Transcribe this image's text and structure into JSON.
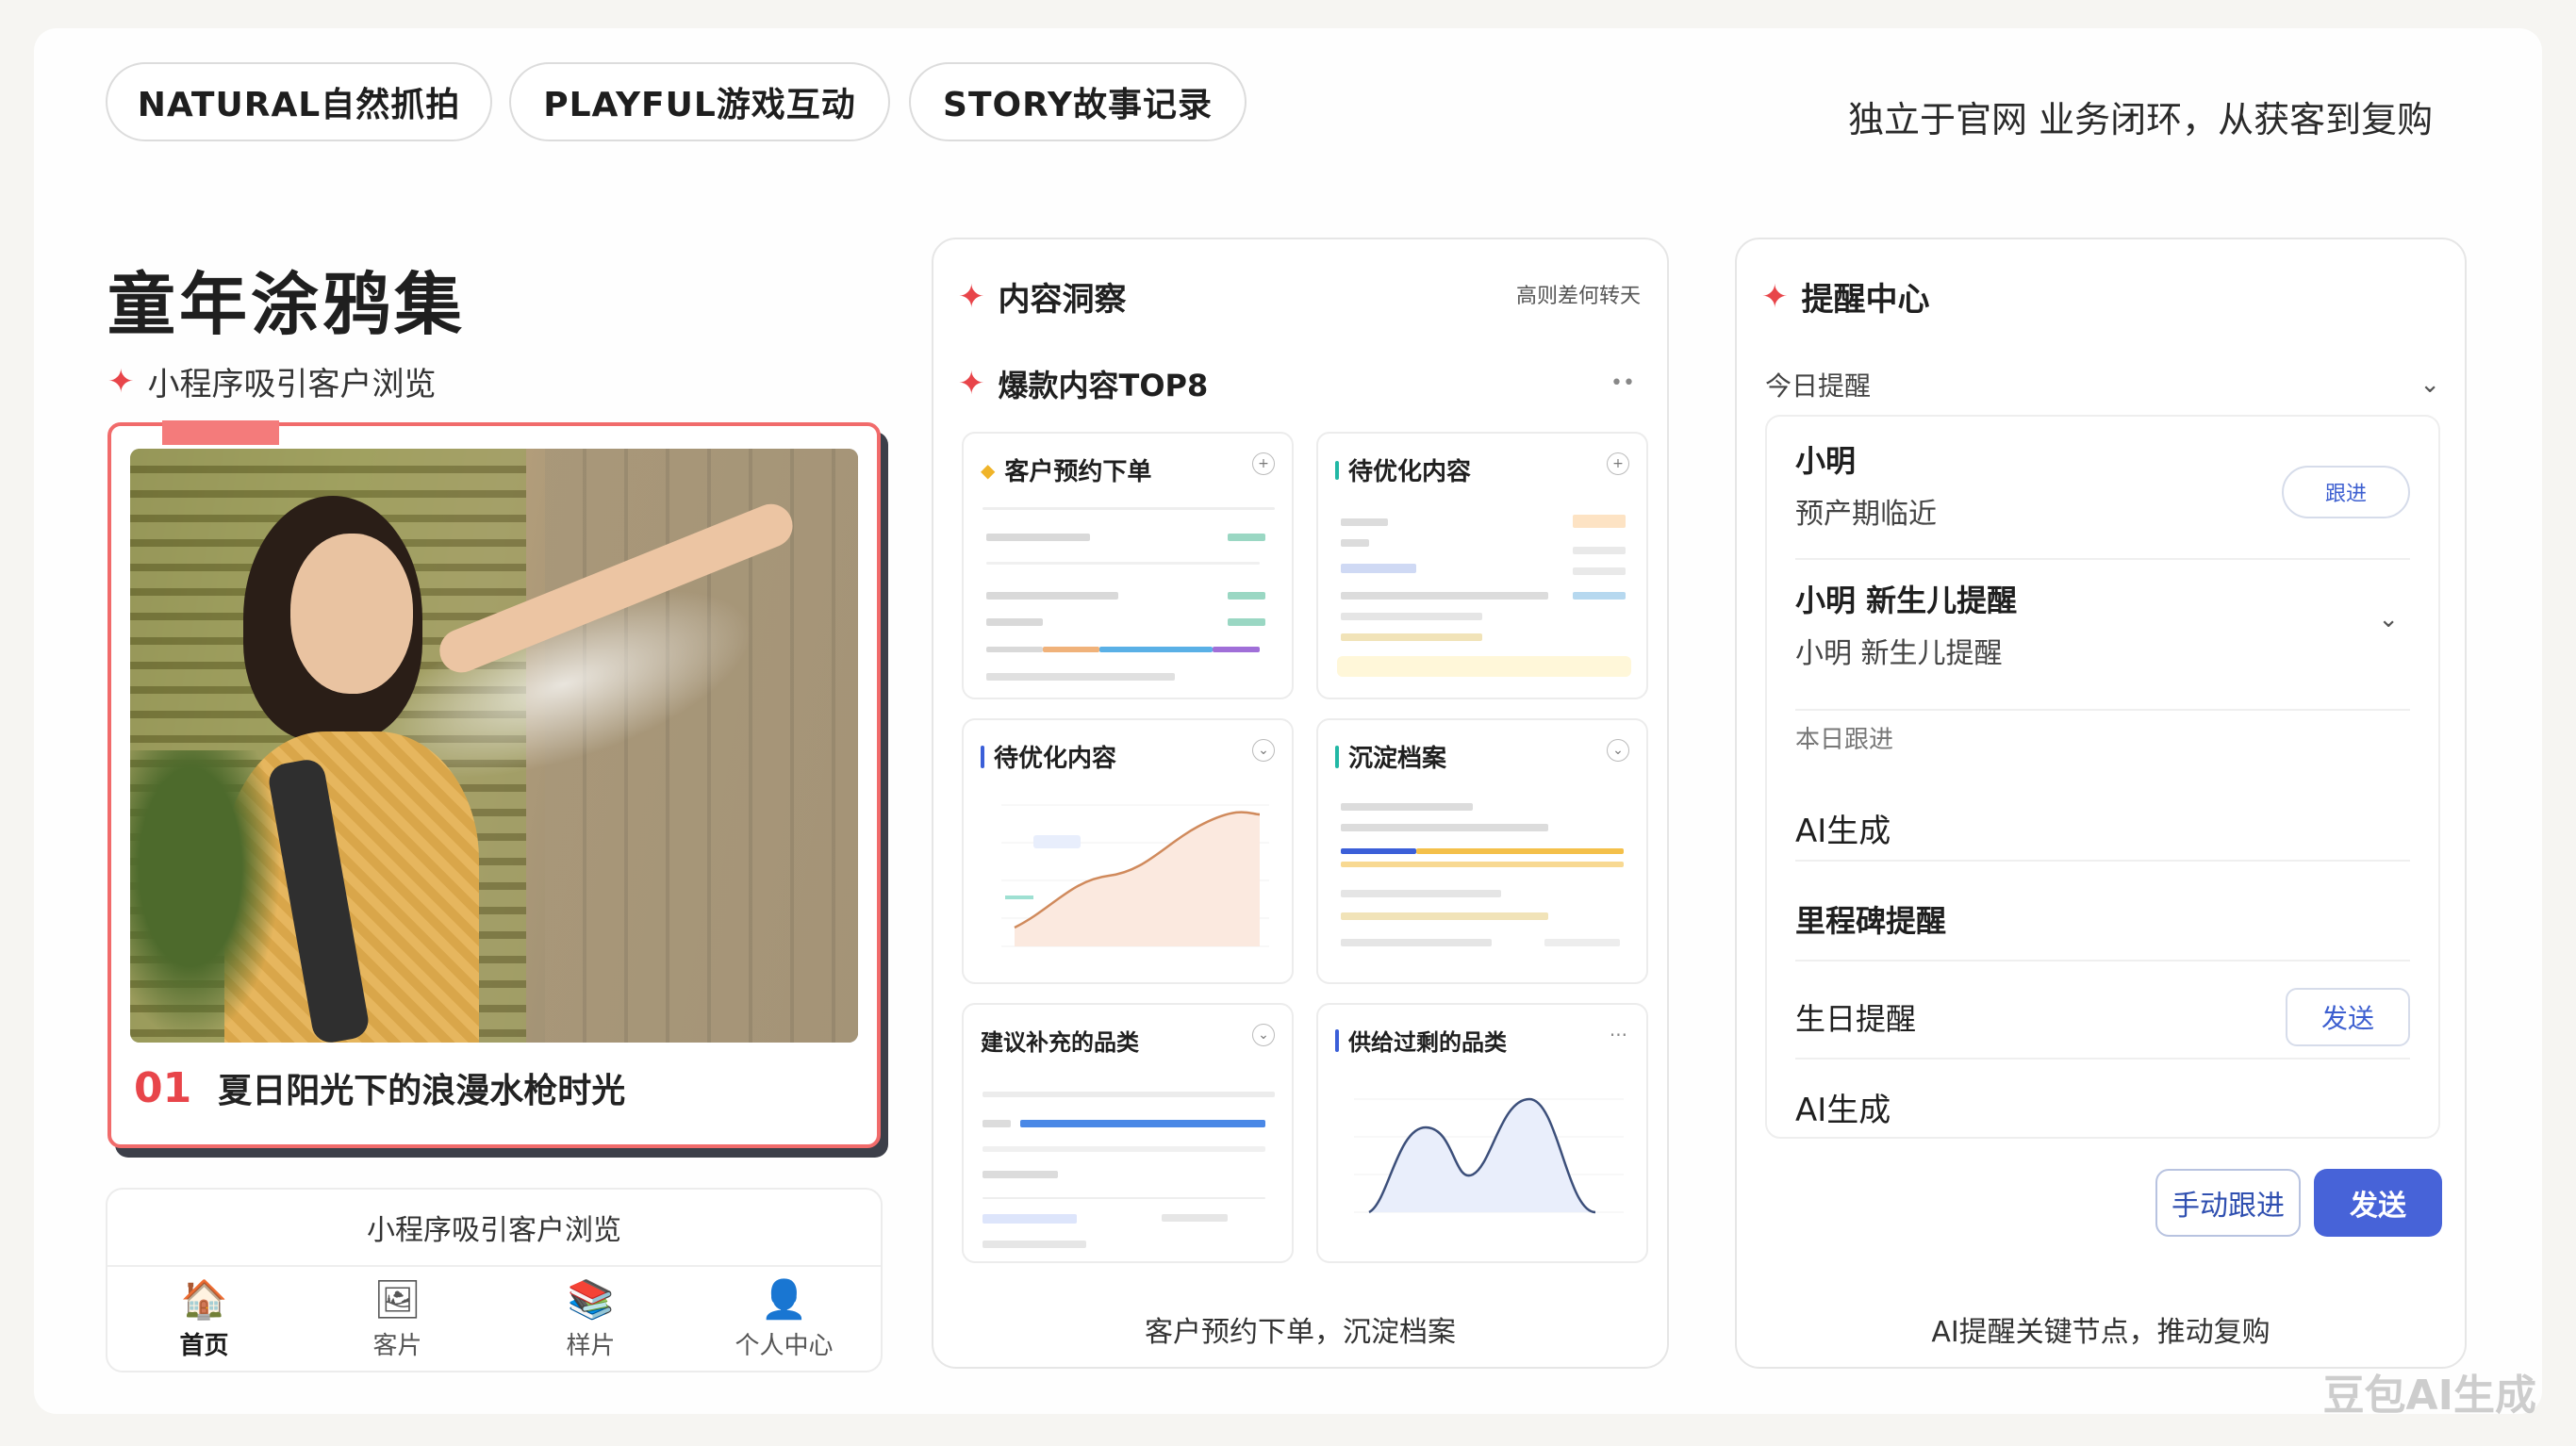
{
  "tags": [
    "NATURAL自然抓拍",
    "PLAYFUL游戏互动",
    "STORY故事记录"
  ],
  "slogan": "独立于官网 业务闭环，从获客到复购",
  "left": {
    "title": "童年涂鸦集",
    "subtitle": "小程序吸引客户浏览",
    "photo_alt": "woman-with-water-hose-photo",
    "caption_num": "01",
    "caption_text": "夏日阳光下的浪漫水枪时光",
    "miniapp": {
      "header": "小程序吸引客户浏览",
      "nav": [
        {
          "icon": "🏠",
          "label": "首页"
        },
        {
          "icon": "🖼",
          "label": "客片"
        },
        {
          "icon": "📚",
          "label": "样片"
        },
        {
          "icon": "👤",
          "label": "个人中心"
        }
      ]
    }
  },
  "middle": {
    "title": "内容洞察",
    "meta": "高则差何转天",
    "subtitle": "爆款内容TOP8",
    "cards": [
      {
        "title": "客户预约下单"
      },
      {
        "title": "待优化内容"
      },
      {
        "title": "待优化内容"
      },
      {
        "title": "沉淀档案"
      },
      {
        "title": "建议补充的品类"
      },
      {
        "title": "供给过剩的品类"
      }
    ],
    "footer": "客户预约下单，沉淀档案"
  },
  "right": {
    "title": "提醒中心",
    "select_label": "今日提醒",
    "rows": [
      {
        "title": "小明",
        "sub": "预产期临近",
        "pill": "跟进"
      },
      {
        "title": "小明 新生儿提醒",
        "sub": "小明 新生儿提醒"
      },
      {
        "section": "本日跟进"
      },
      {
        "title": "AI生成"
      },
      {
        "title": "里程碑提醒"
      },
      {
        "title": "生日提醒",
        "pill": "发送"
      },
      {
        "title": "AI生成"
      }
    ],
    "btn_manual": "手动跟进",
    "btn_send": "发送",
    "footer": "AI提醒关键节点，推动复购"
  },
  "watermark": "豆包AI生成",
  "colors": {
    "accent": "#e8454a",
    "primary": "#4763d8"
  }
}
